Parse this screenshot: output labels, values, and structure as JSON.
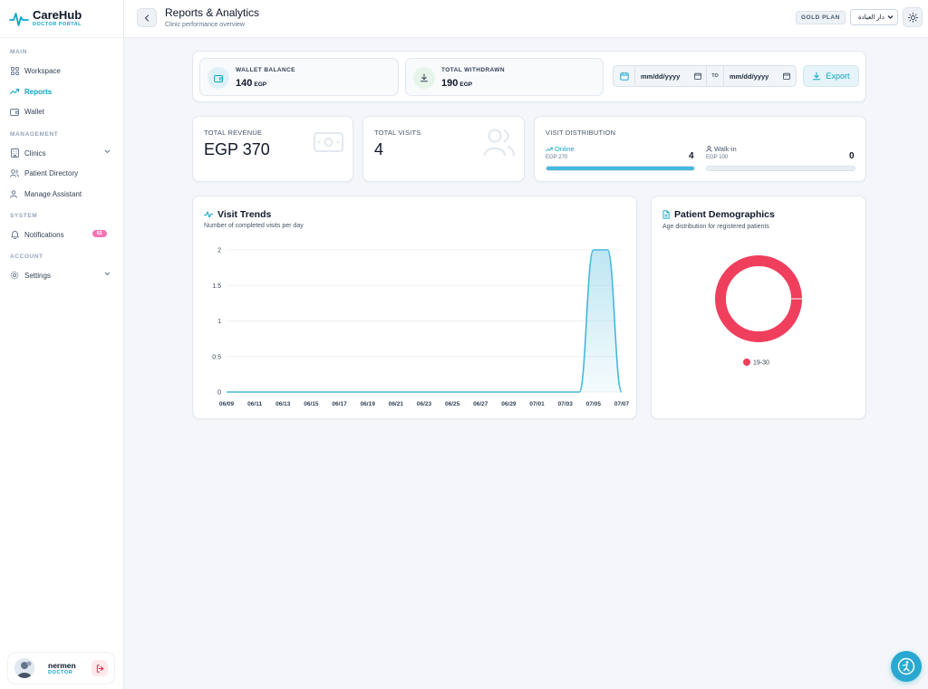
{
  "brand": {
    "name": "CareHub",
    "subtitle": "DOCTOR PORTAL"
  },
  "sidebar": {
    "sections": [
      {
        "label": "MAIN"
      },
      {
        "label": "MANAGEMENT"
      },
      {
        "label": "SYSTEM"
      },
      {
        "label": "ACCOUNT"
      }
    ],
    "items": [
      {
        "label": "Workspace",
        "icon": "grid-icon"
      },
      {
        "label": "Reports",
        "icon": "trend-icon",
        "active": true
      },
      {
        "label": "Wallet",
        "icon": "wallet-icon"
      },
      {
        "label": "Clinics",
        "icon": "building-icon"
      },
      {
        "label": "Patient Directory",
        "icon": "users-icon"
      },
      {
        "label": "Manage Assistant",
        "icon": "user-cog-icon"
      },
      {
        "label": "Notifications",
        "icon": "bell-icon",
        "badge": "81"
      },
      {
        "label": "Settings",
        "icon": "gear-icon"
      }
    ],
    "user": {
      "name": "nermen",
      "role": "DOCTOR"
    }
  },
  "header": {
    "title": "Reports & Analytics",
    "subtitle": "Clinic performance overview",
    "plan": "GOLD PLAN",
    "language": "دار العيادة"
  },
  "toolbar": {
    "wallet_balance_label": "WALLET BALANCE",
    "wallet_balance_value": "140",
    "wallet_balance_unit": "EGP",
    "total_withdrawn_label": "TOTAL WITHDRAWN",
    "total_withdrawn_value": "190",
    "total_withdrawn_unit": "EGP",
    "date_from_placeholder": "mm/dd/yyyy",
    "date_to_label": "TO",
    "date_to_placeholder": "mm/dd/yyyy",
    "export_label": "Export"
  },
  "stats": {
    "revenue_label": "TOTAL REVENUE",
    "revenue_value": "EGP 370",
    "visits_label": "TOTAL VISITS",
    "visits_value": "4",
    "distribution_label": "VISIT DISTRIBUTION",
    "online_label": "Online",
    "online_sub": "EGP 270",
    "online_count": "4",
    "online_fraction": 1.0,
    "walkin_label": "Walk-in",
    "walkin_sub": "EGP 100",
    "walkin_count": "0",
    "walkin_fraction": 0.0
  },
  "trends": {
    "title": "Visit Trends",
    "subtitle": "Number of completed visits per day"
  },
  "demographics": {
    "title": "Patient Demographics",
    "subtitle": "Age distribution for registered patients",
    "legend": "19-30",
    "color": "#f03e5d"
  },
  "colors": {
    "accent": "#0ea5c6",
    "line": "#45b8dc",
    "donut": "#f03e5d"
  },
  "chart_data": [
    {
      "type": "area",
      "title": "Visit Trends",
      "xlabel": "",
      "ylabel": "",
      "x": [
        "06/09",
        "06/10",
        "06/11",
        "06/12",
        "06/13",
        "06/14",
        "06/15",
        "06/16",
        "06/17",
        "06/18",
        "06/19",
        "06/20",
        "06/21",
        "06/22",
        "06/23",
        "06/24",
        "06/25",
        "06/26",
        "06/27",
        "06/28",
        "06/29",
        "06/30",
        "07/01",
        "07/02",
        "07/03",
        "07/04",
        "07/05",
        "07/06",
        "07/07"
      ],
      "values": [
        0,
        0,
        0,
        0,
        0,
        0,
        0,
        0,
        0,
        0,
        0,
        0,
        0,
        0,
        0,
        0,
        0,
        0,
        0,
        0,
        0,
        0,
        0,
        0,
        0,
        0,
        2,
        2,
        0
      ],
      "x_tick_labels": [
        "06/09",
        "06/11",
        "06/13",
        "06/15",
        "06/17",
        "06/19",
        "06/21",
        "06/23",
        "06/25",
        "06/27",
        "06/29",
        "07/01",
        "07/03",
        "07/05",
        "07/07"
      ],
      "y_ticks": [
        "0",
        "0.5",
        "1",
        "1.5",
        "2"
      ],
      "ylim": [
        0,
        2
      ],
      "grid": true,
      "color": "#45b8dc"
    },
    {
      "type": "pie",
      "title": "Patient Demographics",
      "categories": [
        "19-30"
      ],
      "values": [
        100
      ],
      "colors": [
        "#f03e5d"
      ],
      "legend": "bottom"
    }
  ]
}
